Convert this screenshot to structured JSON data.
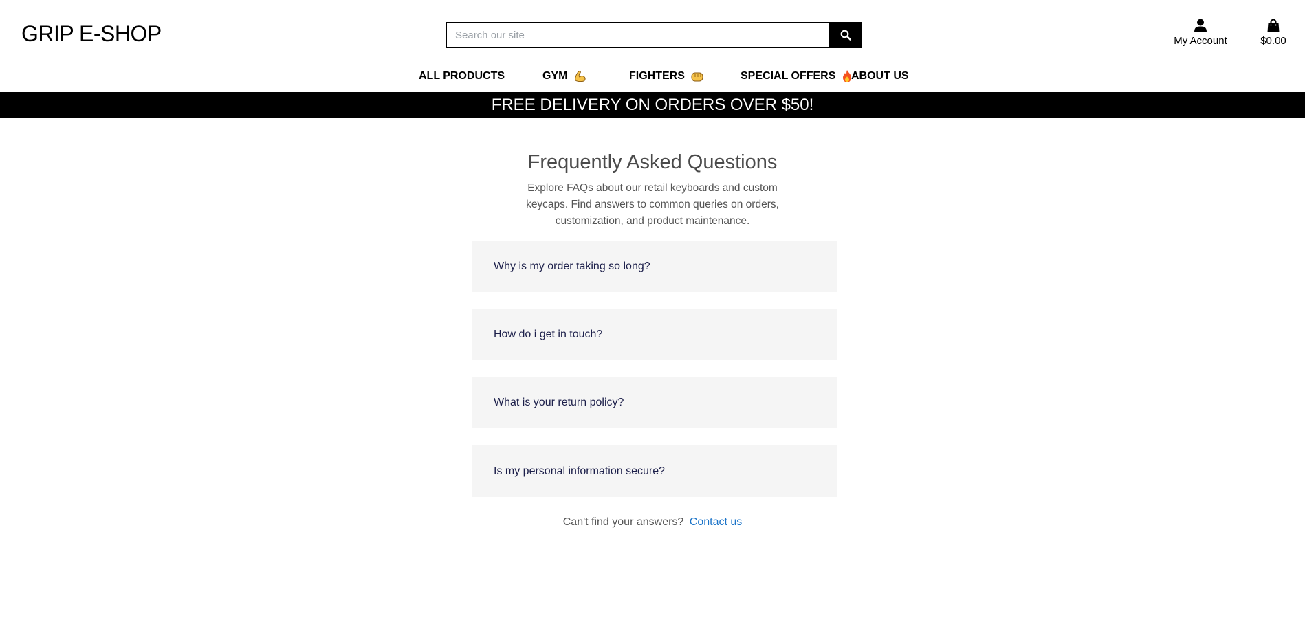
{
  "header": {
    "logo": "GRIP E-SHOP",
    "search": {
      "placeholder": "Search our site",
      "value": ""
    },
    "account_label": "My Account",
    "cart_total": "$0.00"
  },
  "nav": [
    {
      "label": "ALL PRODUCTS",
      "emoji": ""
    },
    {
      "label": "GYM",
      "emoji": "flexed-biceps-icon"
    },
    {
      "label": "FIGHTERS",
      "emoji": "oncoming-fist-icon"
    },
    {
      "label": "SPECIAL OFFERS",
      "emoji": "fire-icon"
    },
    {
      "label": "ABOUT US",
      "emoji": ""
    }
  ],
  "banner": {
    "text": "FREE DELIVERY ON ORDERS OVER $50!"
  },
  "faq": {
    "title": "Frequently Asked Questions",
    "intro": "Explore FAQs about our retail keyboards and custom keycaps. Find answers to common queries on orders, customization, and product maintenance.",
    "items": [
      {
        "question": "Why is my order taking so long?"
      },
      {
        "question": "How do i get in touch?"
      },
      {
        "question": "What is your return policy?"
      },
      {
        "question": "Is my personal information secure?"
      }
    ],
    "contact_prompt": "Can't find your answers?",
    "contact_link": "Contact us"
  },
  "colors": {
    "banner_bg": "#000000",
    "faq_item_bg": "#f5f5f5",
    "link": "#1a73c8",
    "faq_question": "#1c1f4a"
  }
}
